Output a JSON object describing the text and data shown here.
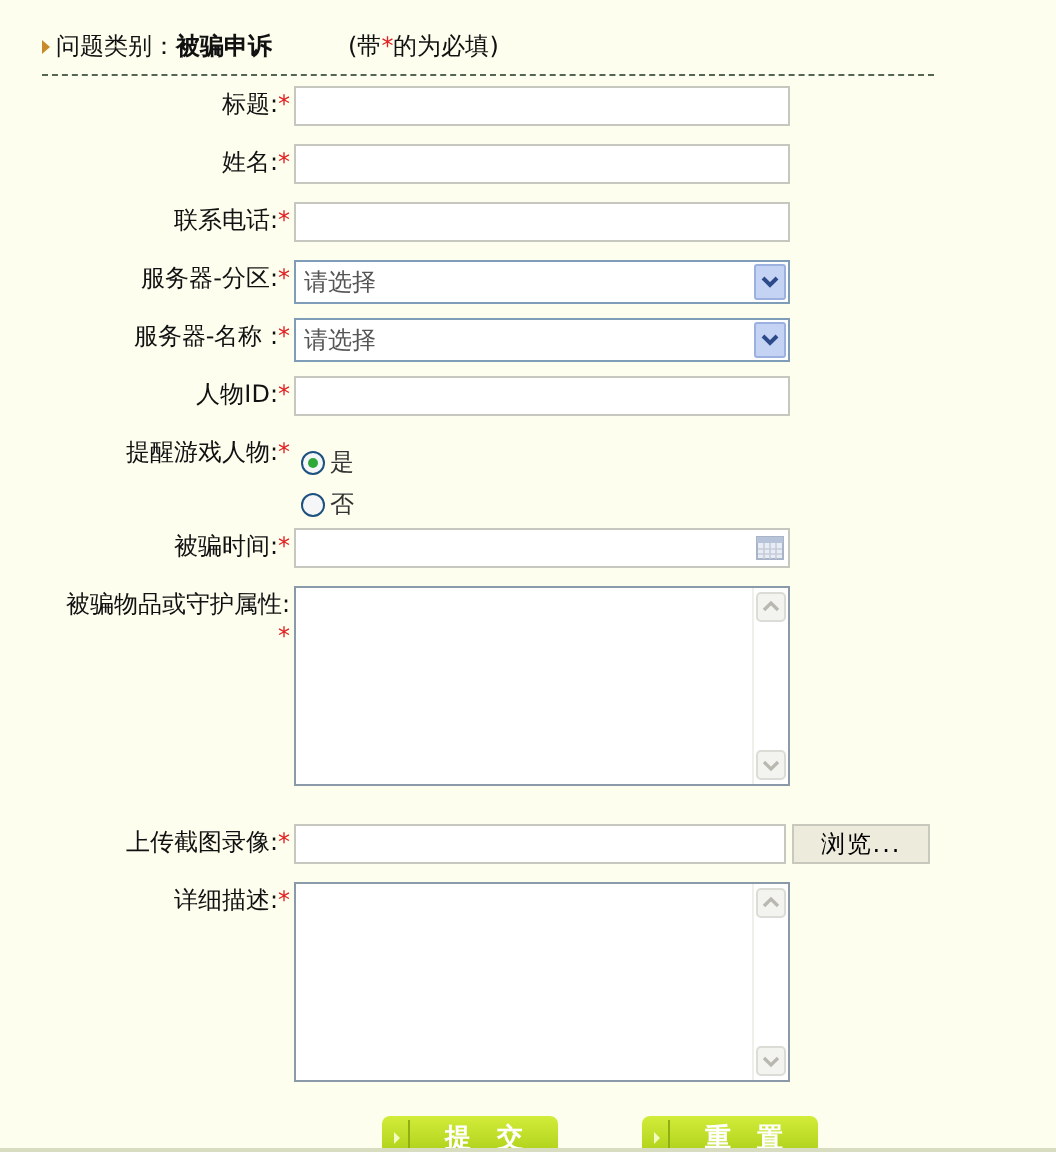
{
  "header": {
    "category_label": "问题类别：",
    "category_value": "被骗申诉",
    "note_before": "(带",
    "note_mark": "*",
    "note_after": "的为必填)"
  },
  "required_mark": "*",
  "fields": [
    {
      "kind": "text",
      "label": "标题:",
      "required": true
    },
    {
      "kind": "text",
      "label": "姓名:",
      "required": true
    },
    {
      "kind": "text",
      "label": "联系电话:",
      "required": true
    },
    {
      "kind": "select",
      "label": "服务器-分区:",
      "required": true,
      "value": "请选择"
    },
    {
      "kind": "select",
      "label": "服务器-名称 :",
      "required": true,
      "value": "请选择"
    },
    {
      "kind": "text",
      "label": "人物ID:",
      "required": true
    },
    {
      "kind": "radio",
      "label": "提醒游戏人物:",
      "required": true,
      "options": [
        {
          "label": "是",
          "selected": true
        },
        {
          "label": "否",
          "selected": false
        }
      ]
    },
    {
      "kind": "date",
      "label": "被骗时间:",
      "required": true
    },
    {
      "kind": "textarea",
      "label": "被骗物品或守护属性:",
      "required": true
    },
    {
      "kind": "file",
      "label": "上传截图录像:",
      "required": true,
      "button": "浏览..."
    },
    {
      "kind": "textarea",
      "label": "详细描述:",
      "required": true
    }
  ],
  "buttons": [
    "提　交",
    "重　置"
  ]
}
